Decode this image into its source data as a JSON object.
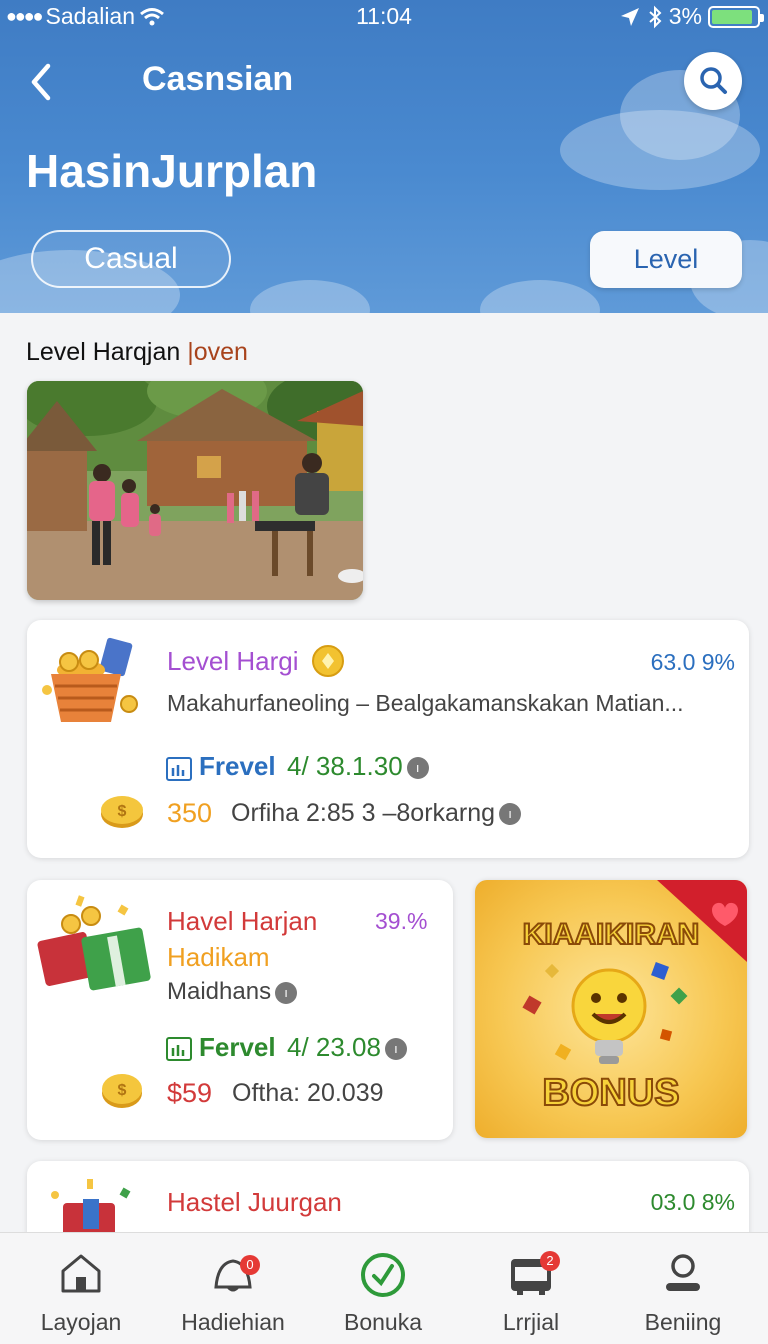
{
  "status_bar": {
    "carrier": "Sadalian",
    "time": "11:04",
    "battery_percent": "3%",
    "battery_level": 0.9
  },
  "header": {
    "nav_title": "Casnsian",
    "title": "HasinJurplan",
    "filters": {
      "casual": "Casual",
      "level": "Level"
    }
  },
  "section": {
    "title": "Level Harqjan ",
    "title_accent": "|oven"
  },
  "cards": [
    {
      "title": "Level Hargi",
      "percent": "63.0 9%",
      "description": "Makahurfaneoling – Bealgakamanskakan Matian...",
      "stat_label": "Frevel",
      "stat_value": "4/  38.1.30",
      "price": "350",
      "price_label": "Orfiha 2:85 3 –8orkarng",
      "icon": "coin-basket-icon"
    },
    {
      "title": "Havel Harjan",
      "subtitle": "Hadikam",
      "percent": "39.%",
      "description": "Maidhans",
      "stat_label": "Fervel",
      "stat_value": "4/  23.08",
      "price": "$59",
      "price_label": "Ofthа: 20.039",
      "icon": "gift-boxes-icon"
    },
    {
      "title": "Hastel Juurgan",
      "percent": "03.0 8%",
      "icon": "gift-box-icon"
    }
  ],
  "bonus_banner": {
    "top_text": "KIAAIKIRAN",
    "bottom_text": "BONUS"
  },
  "bottom_nav": [
    {
      "label": "Layojan",
      "icon": "home-icon"
    },
    {
      "label": "Hadiehian",
      "icon": "bell-icon",
      "badge": "0"
    },
    {
      "label": "Bonuka",
      "icon": "check-circle-icon"
    },
    {
      "label": "Lrrjial",
      "icon": "calendar-icon",
      "badge": "2"
    },
    {
      "label": "Beniing",
      "icon": "profile-icon"
    }
  ],
  "colors": {
    "header_blue": "#4a8ad0",
    "accent_purple": "#a44fd1",
    "accent_green": "#2d8a2e",
    "accent_red": "#d23a3a",
    "accent_orange": "#f0a021"
  }
}
